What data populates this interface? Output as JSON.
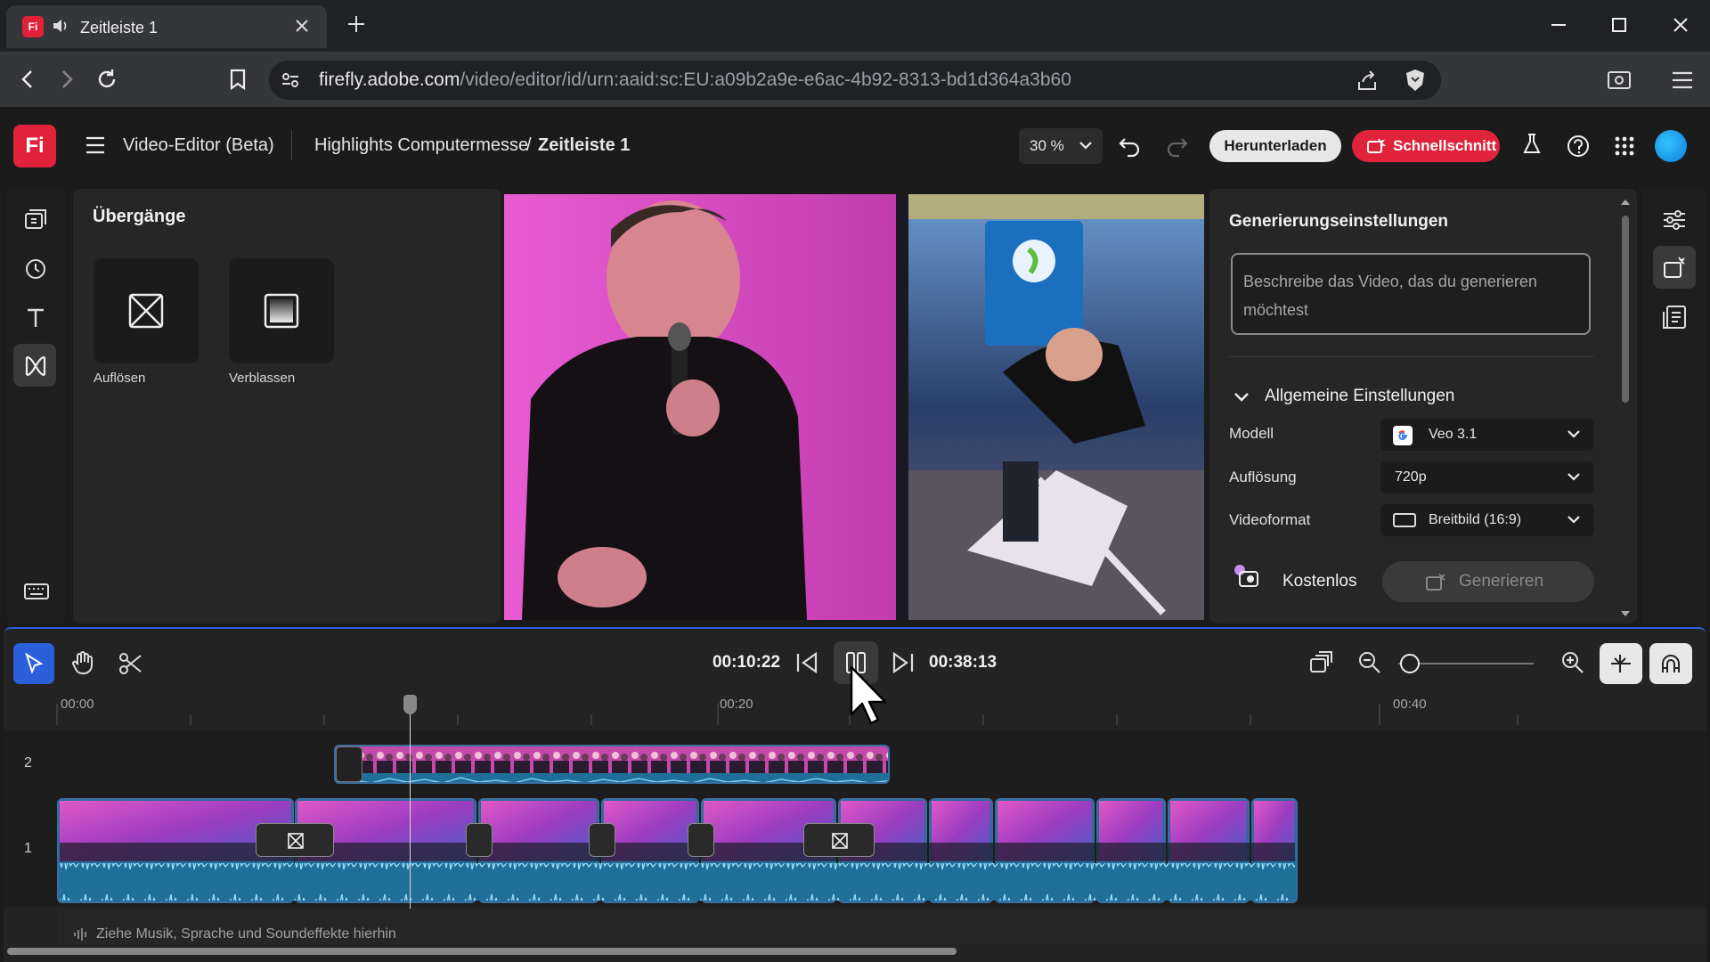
{
  "browser": {
    "tab_title": "Zeitleiste 1",
    "favicon_label": "Fi",
    "url_domain": "firefly.adobe.com",
    "url_path": "/video/editor/id/urn:aaid:sc:EU:a09b2a9e-e6ac-4b92-8313-bd1d364a3b60"
  },
  "header": {
    "logo": "Fi",
    "app_name": "Video-Editor (Beta)",
    "project": "Highlights Computermesse",
    "separator": "/",
    "timeline_name": "Zeitleiste 1",
    "zoom": "30 %",
    "download_label": "Herunterladen",
    "quickcut_label": "Schnellschnitt"
  },
  "transitions": {
    "title": "Übergänge",
    "items": [
      {
        "label": "Auflösen",
        "icon": "dissolve-icon"
      },
      {
        "label": "Verblassen",
        "icon": "fade-icon"
      }
    ]
  },
  "generation": {
    "title": "Generierungseinstellungen",
    "prompt_placeholder": "Beschreibe das Video, das du generieren möchtest",
    "section": "Allgemeine Einstellungen",
    "settings": [
      {
        "label": "Modell",
        "value": "Veo 3.1",
        "icon": "google-icon"
      },
      {
        "label": "Auflösung",
        "value": "720p",
        "icon": ""
      },
      {
        "label": "Videoformat",
        "value": "Breitbild (16:9)",
        "icon": "widescreen-icon"
      }
    ],
    "cost_label": "Kostenlos",
    "generate_label": "Generieren"
  },
  "timeline": {
    "current_time": "00:10:22",
    "total_time": "00:38:13",
    "ruler_labels": [
      "00:00",
      "00:20",
      "00:40"
    ],
    "track_labels": [
      "2",
      "1"
    ],
    "drop_hint": "Ziehe Musik, Sprache und Soundeffekte hierhin"
  },
  "colors": {
    "accent_red": "#e0233b",
    "timeline_blue": "#2b5fd9",
    "clip_audio": "#1f6f99"
  }
}
